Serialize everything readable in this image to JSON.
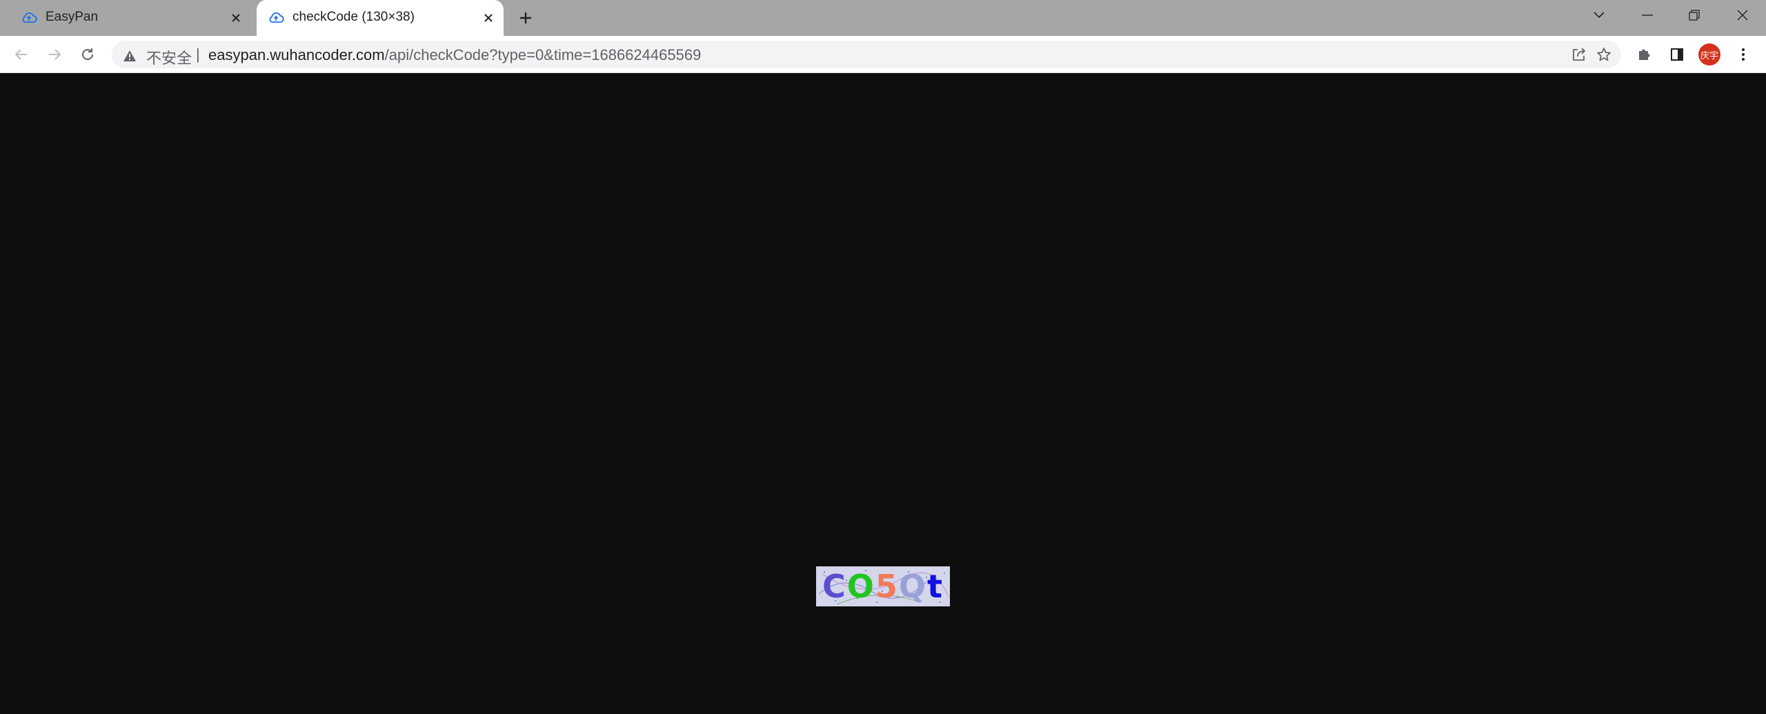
{
  "tabs": [
    {
      "title": "EasyPan",
      "icon": "cloud-upload-icon",
      "active": false
    },
    {
      "title": "checkCode (130×38)",
      "icon": "cloud-upload-icon",
      "active": true
    }
  ],
  "address_bar": {
    "security_label": "不安全",
    "separator": "|",
    "host": "easypan.wuhancoder.com",
    "path": "/api/checkCode?type=0&time=1686624465569"
  },
  "profile": {
    "avatar_text": "庆宇",
    "color": "#d4311c"
  },
  "captcha": {
    "characters": [
      {
        "char": "C",
        "color": "#5a4fcf"
      },
      {
        "char": "O",
        "color": "#22c522"
      },
      {
        "char": "5",
        "color": "#f07a5a"
      },
      {
        "char": "Q",
        "color": "#9aa0d8"
      },
      {
        "char": "t",
        "color": "#1010e0"
      }
    ],
    "background": "#d4d6ec"
  },
  "colors": {
    "tabstrip": "#a6a6a6",
    "page_background": "#0e0e0e",
    "tab_icon": "#1a73e8"
  }
}
